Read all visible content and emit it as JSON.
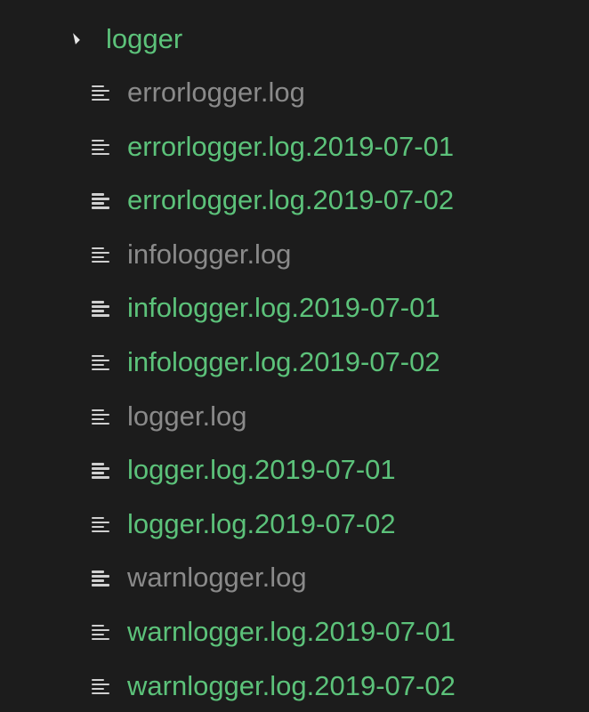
{
  "colors": {
    "background": "#1c1c1c",
    "folder": "#5cc27a",
    "tracked": "#5cc27a",
    "ignored": "#8a8a8a",
    "icon": "#cfcfcf"
  },
  "folder": {
    "name": "logger",
    "expanded": true,
    "icon": "caret-down-icon"
  },
  "files": [
    {
      "name": "errorlogger.log",
      "status": "ignored"
    },
    {
      "name": "errorlogger.log.2019-07-01",
      "status": "tracked"
    },
    {
      "name": "errorlogger.log.2019-07-02",
      "status": "tracked"
    },
    {
      "name": "infologger.log",
      "status": "ignored"
    },
    {
      "name": "infologger.log.2019-07-01",
      "status": "tracked"
    },
    {
      "name": "infologger.log.2019-07-02",
      "status": "tracked"
    },
    {
      "name": "logger.log",
      "status": "ignored"
    },
    {
      "name": "logger.log.2019-07-01",
      "status": "tracked"
    },
    {
      "name": "logger.log.2019-07-02",
      "status": "tracked"
    },
    {
      "name": "warnlogger.log",
      "status": "ignored"
    },
    {
      "name": "warnlogger.log.2019-07-01",
      "status": "tracked"
    },
    {
      "name": "warnlogger.log.2019-07-02",
      "status": "tracked"
    }
  ]
}
